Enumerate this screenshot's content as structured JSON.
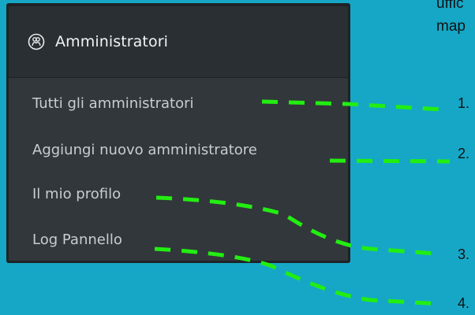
{
  "menu": {
    "title": "Amministratori",
    "icon": "users-icon",
    "items": [
      {
        "label": "Tutti gli amministratori"
      },
      {
        "label": "Aggiungi nuovo amministratore"
      },
      {
        "label": "Il mio profilo"
      },
      {
        "label": "Log Pannello"
      }
    ]
  },
  "annotation": {
    "note_line1": "uffic",
    "note_line2": "map",
    "markers": [
      "1.",
      "2.",
      "3.",
      "4."
    ],
    "line_color": "#22ee11"
  },
  "colors": {
    "background": "#16a7c7",
    "header_bg": "#2a2f33",
    "submenu_bg": "#32373b"
  }
}
